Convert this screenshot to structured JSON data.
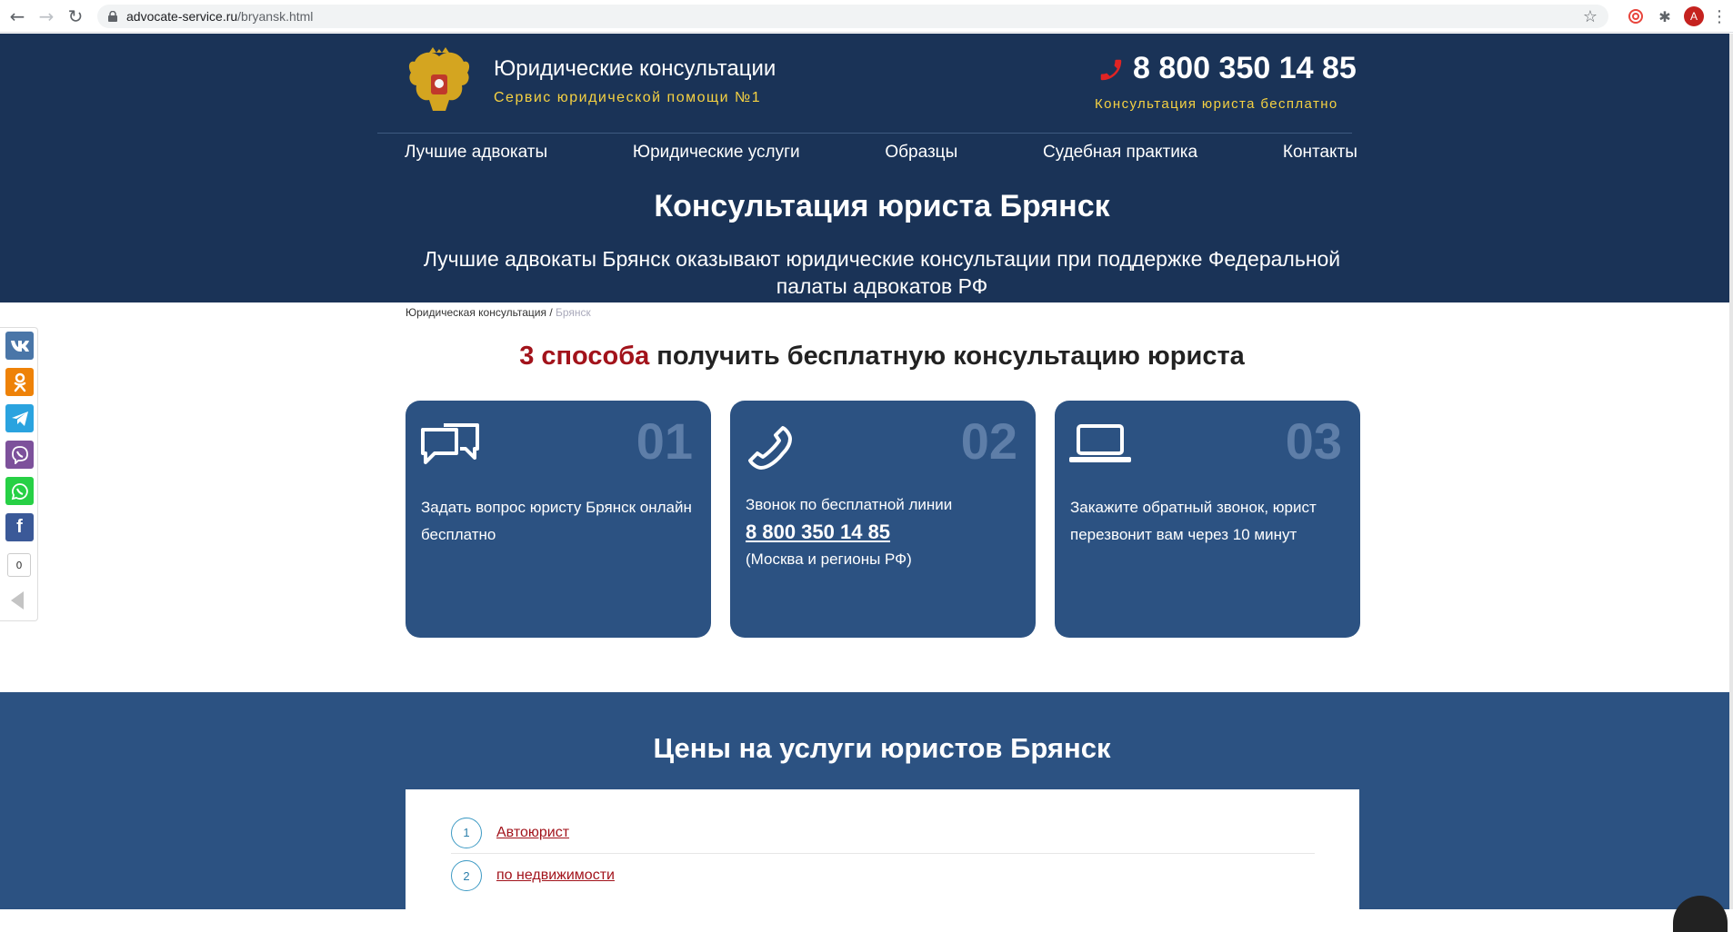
{
  "browser": {
    "url_domain": "advocate-service.ru",
    "url_path": "/bryansk.html",
    "avatar_letter": "A"
  },
  "header": {
    "brand_title": "Юридические консультации",
    "brand_subtitle": "Сервис юридической помощи №1",
    "phone": "8 800 350 14 85",
    "phone_caption": "Консультация юриста бесплатно"
  },
  "menu": [
    {
      "label": "Лучшие адвокаты"
    },
    {
      "label": "Юридические услуги"
    },
    {
      "label": "Образцы"
    },
    {
      "label": "Судебная практика"
    },
    {
      "label": "Контакты"
    }
  ],
  "hero": {
    "title": "Консультация юриста Брянск",
    "subtitle": "Лучшие адвокаты Брянск оказывают юридические консультации при поддержке Федеральной палаты адвокатов РФ"
  },
  "breadcrumb": {
    "home": "Юридическая консультация",
    "separator": " / ",
    "current": "Брянск"
  },
  "share": {
    "count": "0",
    "buttons": [
      {
        "name": "vk",
        "label": "vk",
        "color": "#4a76a8"
      },
      {
        "name": "odnoklassniki",
        "label": "ok",
        "color": "#ee8208"
      },
      {
        "name": "telegram",
        "label": "tg",
        "color": "#2aa3df"
      },
      {
        "name": "viber",
        "label": "vb",
        "color": "#7d519b"
      },
      {
        "name": "whatsapp",
        "label": "wa",
        "color": "#27d045"
      },
      {
        "name": "facebook",
        "label": "f",
        "color": "#3b5998"
      }
    ]
  },
  "ways": {
    "title_accent": "3 способа",
    "title_rest": " получить бесплатную консультацию юриста",
    "cards": [
      {
        "num": "01",
        "text": "Задать вопрос юристу Брянск онлайн бесплатно",
        "icon": "chat-icon"
      },
      {
        "num": "02",
        "text": "Звонок по бесплатной линии",
        "phone": "8 800 350 14 85",
        "note": "(Москва и регионы РФ)",
        "icon": "phone-icon"
      },
      {
        "num": "03",
        "text": "Закажите обратный звонок, юрист перезвонит вам через 10 минут",
        "icon": "laptop-icon"
      }
    ]
  },
  "prices": {
    "title": "Цены на услуги юристов Брянск",
    "items": [
      {
        "num": "1",
        "label": "Автоюрист"
      },
      {
        "num": "2",
        "label": "по недвижимости"
      }
    ]
  },
  "colors": {
    "header_bg": "#1a3357",
    "card_bg": "#2c5282",
    "accent_red": "#a2131b",
    "accent_yellow": "#f5d142"
  }
}
